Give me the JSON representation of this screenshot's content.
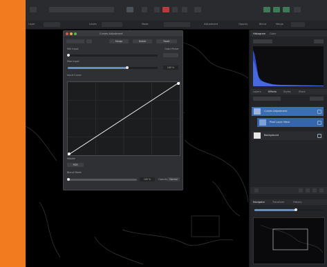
{
  "colors": {
    "accent": "#3b6fb5",
    "sidebar_stripe": "#f27b20",
    "canvas": "#000000",
    "curve": "#e8e8e8"
  },
  "topbar": {
    "icons": [
      "app-icon",
      "view-icon",
      "grid-icon",
      "snap-icon",
      "record-icon",
      "persona-icon",
      "assistant-icon",
      "align-icon",
      "transform-icon"
    ]
  },
  "context_toolbar": {
    "items": [
      "Layer",
      "Levels",
      "Mode",
      "Adjustment",
      "Opacity",
      "Blend",
      "Merge"
    ]
  },
  "dialog": {
    "title": "Curves Adjustment",
    "tabs": [
      "Merge",
      "Delete",
      "Reset"
    ],
    "picker_label": "Color Picker",
    "min_label": "Min Input",
    "max_label": "Max Input",
    "max_value": "100 %",
    "curve_label": "Input Curve",
    "channel_label": "Master",
    "channel_value": "RGB",
    "opacity_label": "Opacity",
    "opacity_value": "100 %",
    "blend_label": "Blend Mode",
    "blend_value": "Normal"
  },
  "right_panel": {
    "tabs_top": [
      "Histogram",
      "Color"
    ],
    "tabs_layers": [
      "Layers",
      "Effects",
      "Styles",
      "Stock"
    ],
    "layers": [
      {
        "name": "Curves Adjustment",
        "selected": true
      },
      {
        "name": "Pixel Layer Mask",
        "selected": true
      },
      {
        "name": "Background",
        "selected": false
      }
    ],
    "tabs_bottom": [
      "Navigator",
      "Transform",
      "History"
    ]
  }
}
